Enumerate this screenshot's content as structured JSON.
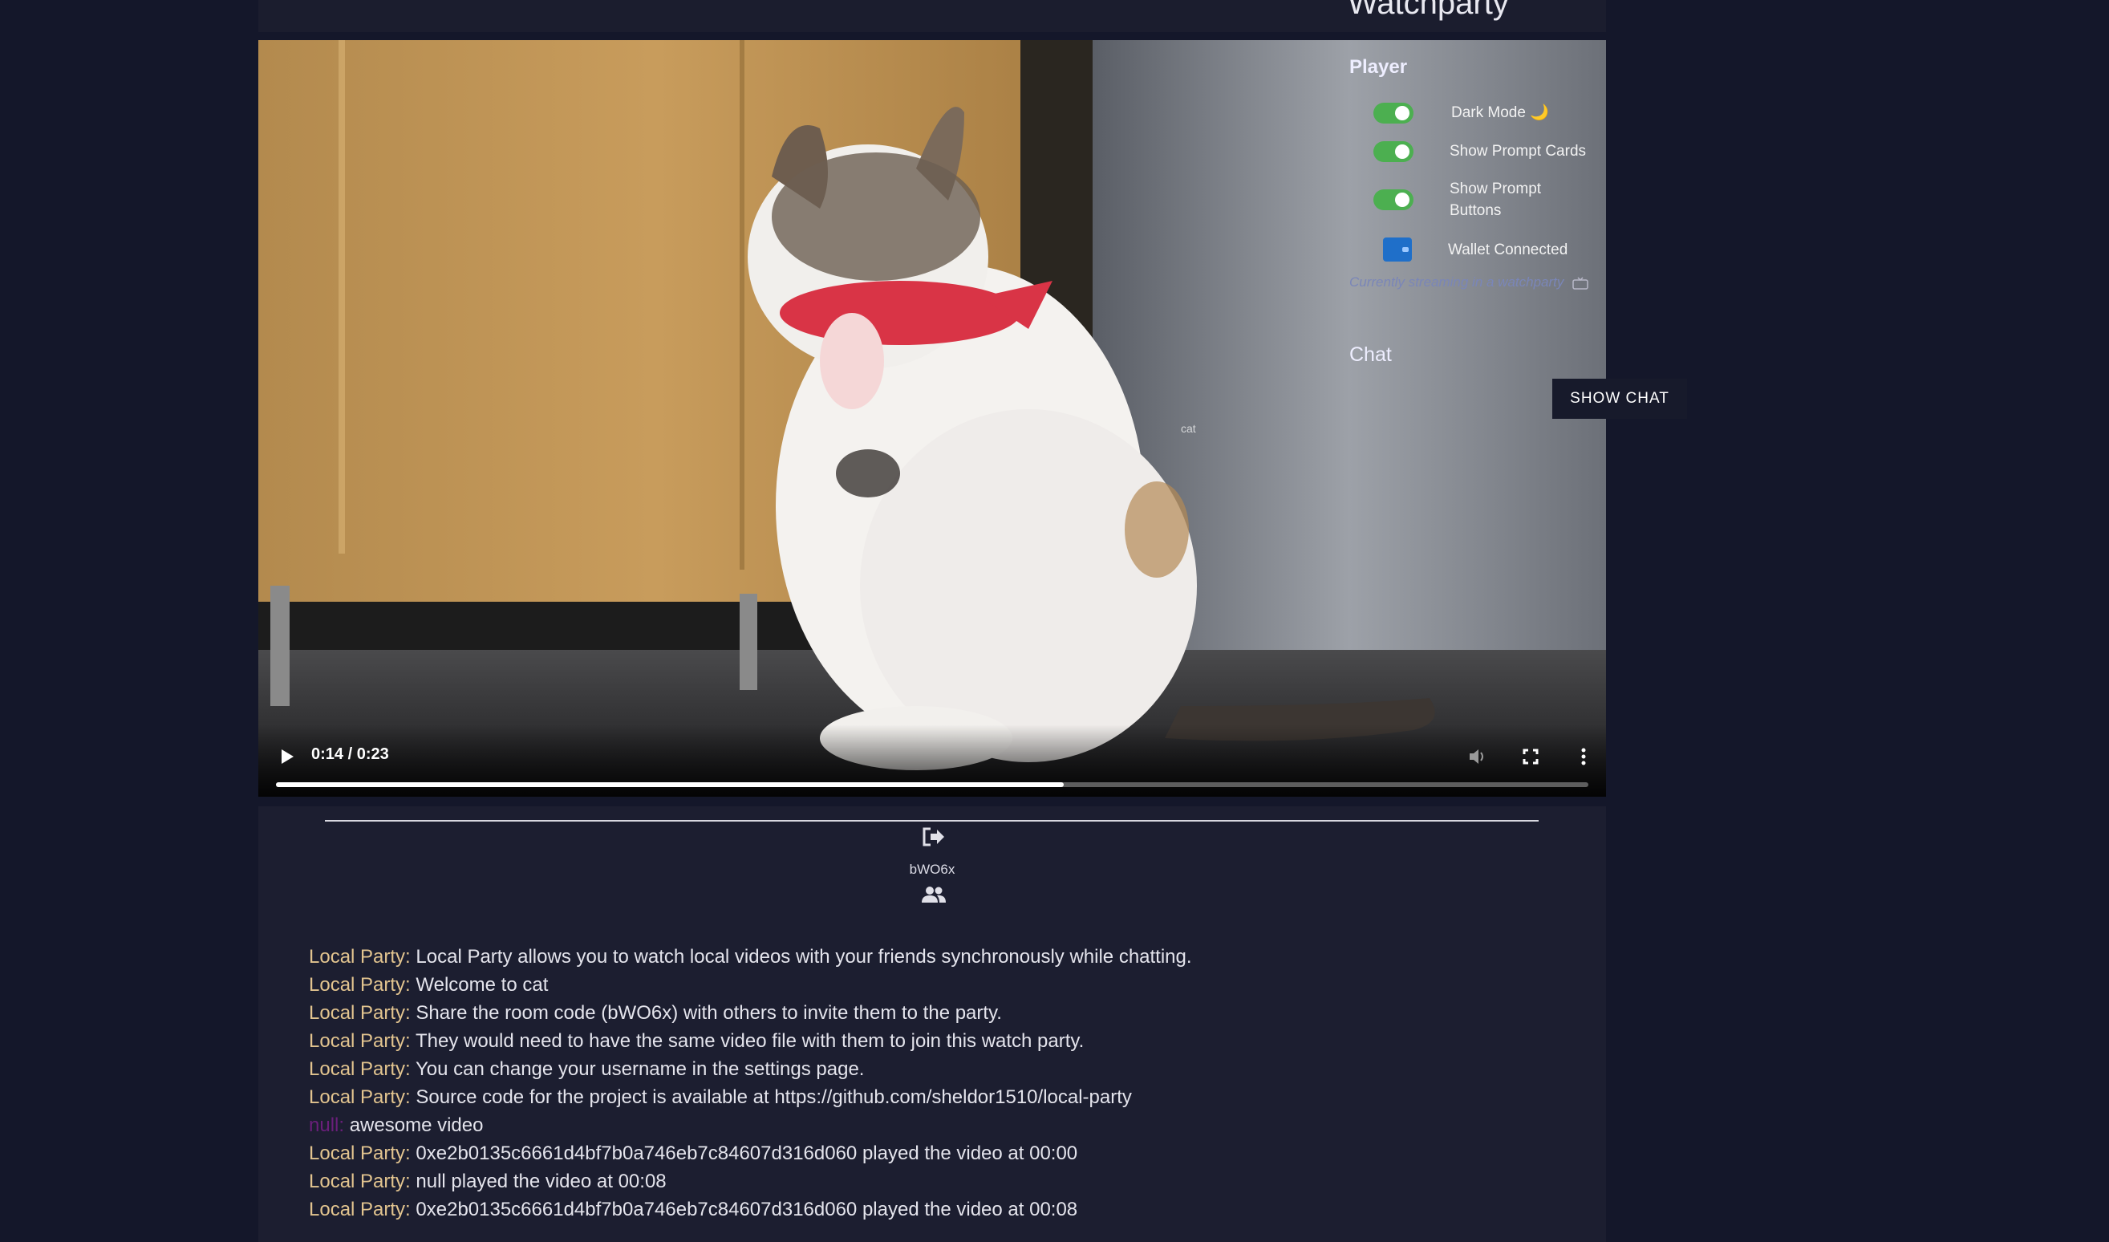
{
  "app": {
    "title": "Watchparty"
  },
  "player": {
    "time_display": "0:14 / 0:23",
    "progress_fraction": 0.6,
    "overlay_label": "cat"
  },
  "settings": {
    "player_heading": "Player",
    "items": [
      {
        "label": "Dark Mode 🌙",
        "type": "toggle",
        "enabled": true
      },
      {
        "label": "Show Prompt Cards",
        "type": "toggle",
        "enabled": true
      },
      {
        "label": "Show Prompt\nButtons",
        "type": "toggle",
        "enabled": true
      },
      {
        "label": "Wallet Connected",
        "type": "wallet"
      }
    ],
    "stream_note": "Currently streaming in a watchparty",
    "chat_heading": "Chat",
    "show_chat_label": "SHOW CHAT"
  },
  "room": {
    "code": "bWO6x"
  },
  "messages": [
    {
      "sender": "Local Party:",
      "text": " Local Party allows you to watch local videos with your friends synchronously while chatting."
    },
    {
      "sender": "Local Party:",
      "text": " Welcome to cat"
    },
    {
      "sender": "Local Party:",
      "text": " Share the room code (bWO6x) with others to invite them to the party."
    },
    {
      "sender": "Local Party:",
      "text": " They would need to have the same video file with them to join this watch party."
    },
    {
      "sender": "Local Party:",
      "text": " You can change your username in the settings page."
    },
    {
      "sender": "Local Party:",
      "text": " Source code for the project is available at https://github.com/sheldor1510/local-party"
    },
    {
      "sender": "null:",
      "text": " awesome video",
      "null_user": true
    },
    {
      "sender": "Local Party:",
      "text": " 0xe2b0135c6661d4bf7b0a746eb7c84607d316d060 played the video at 00:00"
    },
    {
      "sender": "Local Party:",
      "text": " null played the video at 00:08"
    },
    {
      "sender": "Local Party:",
      "text": " 0xe2b0135c6661d4bf7b0a746eb7c84607d316d060 played the video at 00:08"
    }
  ],
  "colors": {
    "toggle_on": "#4caf50",
    "sender": "#e2c48f",
    "null_sender": "#6a1f7a",
    "background": "#14172a"
  },
  "icons": {
    "play": "play-icon",
    "volume": "volume-icon",
    "fullscreen": "fullscreen-icon",
    "more": "more-vertical-icon",
    "leave": "leave-room-icon",
    "users": "users-icon",
    "wallet": "wallet-icon"
  }
}
